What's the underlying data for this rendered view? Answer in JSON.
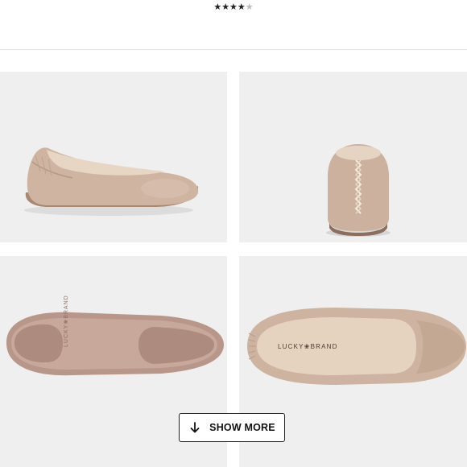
{
  "rating": {
    "stars_full": "★★★★",
    "stars_partial": "★",
    "value_fraction_of_five": 0.9
  },
  "gallery": {
    "images": [
      {
        "icon": "shoe-side-view",
        "alt": "ballet flat side view"
      },
      {
        "icon": "shoe-back-view",
        "alt": "ballet flat heel view"
      },
      {
        "icon": "shoe-sole-view",
        "alt": "ballet flat outsole"
      },
      {
        "icon": "shoe-top-view",
        "alt": "ballet flat insole top view"
      }
    ],
    "sole_brand_text": "LUCKY❀BRAND",
    "insole_brand_text": "LUCKY❀BRAND"
  },
  "show_more": {
    "label": "SHOW MORE",
    "icon": "arrow-down-icon"
  },
  "colors": {
    "tile_bg": "#efefef",
    "shoe_leather": "#cdb3a0",
    "shoe_shadow": "#b59a86",
    "insole": "#e6d3bf",
    "sole": "#b8978a"
  }
}
